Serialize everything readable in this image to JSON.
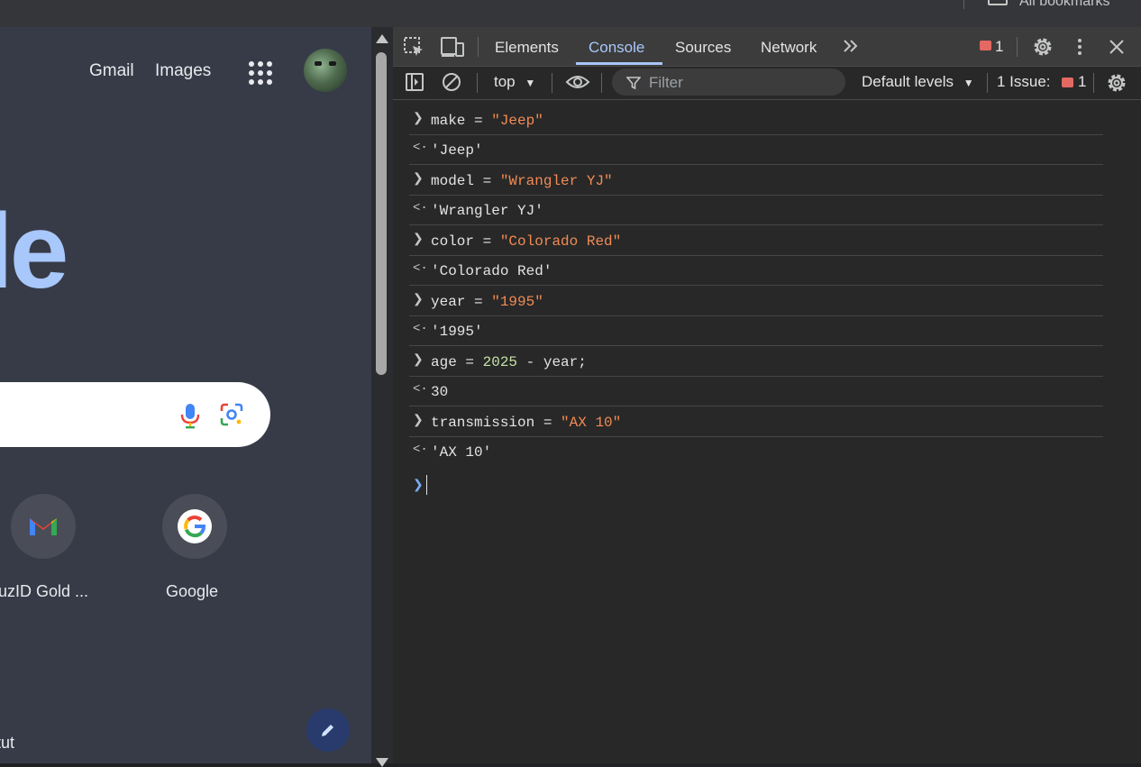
{
  "bookmarks_bar": {
    "label": "All bookmarks"
  },
  "google_page": {
    "top_links": [
      "Gmail",
      "Images"
    ],
    "logo_text": "le",
    "shortcuts": [
      {
        "label": "uzID Gold ...",
        "icon": "gmail-icon"
      },
      {
        "label": "Google",
        "icon": "google-g-icon"
      }
    ],
    "customize_label": "tut"
  },
  "devtools": {
    "tabs": [
      "Elements",
      "Console",
      "Sources",
      "Network"
    ],
    "active_tab": "Console",
    "error_count": "1",
    "context": "top",
    "filter_placeholder": "Filter",
    "levels": "Default levels",
    "issues_label": "1 Issue:",
    "issues_count": "1",
    "accent_color": "#a8c7fa"
  },
  "console": {
    "entries": [
      {
        "input_var": "make",
        "input_op": " = ",
        "input_val": "\"Jeep\"",
        "output": "'Jeep'"
      },
      {
        "input_var": "model",
        "input_op": " = ",
        "input_val": "\"Wrangler YJ\"",
        "output": "'Wrangler YJ'"
      },
      {
        "input_var": "color",
        "input_op": " = ",
        "input_val": "\"Colorado Red\"",
        "output": "'Colorado Red'"
      },
      {
        "input_var": "year",
        "input_op": " = ",
        "input_val": "\"1995\"",
        "output": "'1995'"
      },
      {
        "input_var": "age",
        "input_op": " = ",
        "input_num": "2025",
        "input_rest": " - year;",
        "output": "30"
      },
      {
        "input_var": "transmission",
        "input_op": " = ",
        "input_val": "\"AX 10\"",
        "output": "'AX 10'"
      }
    ]
  }
}
